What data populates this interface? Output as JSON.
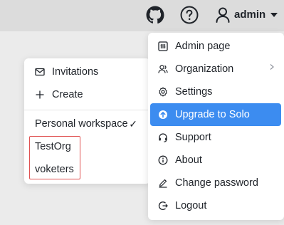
{
  "header": {
    "github_icon": "github-icon",
    "help_icon": "help-icon",
    "user_icon": "user-icon",
    "username": "admin"
  },
  "workspace_menu": {
    "items": [
      {
        "label": "Invitations",
        "icon": "mail-icon"
      },
      {
        "label": "Create",
        "icon": "plus-icon"
      }
    ],
    "workspaces": [
      {
        "label": "Personal workspace",
        "checked": true,
        "check": "✓"
      },
      {
        "label": "TestOrg"
      },
      {
        "label": "voketers"
      }
    ]
  },
  "user_menu": {
    "items": [
      {
        "label": "Admin page",
        "icon": "admin-page-icon"
      },
      {
        "label": "Organization",
        "icon": "organization-icon",
        "has_submenu": true
      },
      {
        "label": "Settings",
        "icon": "gear-icon"
      },
      {
        "label": "Upgrade to Solo",
        "icon": "upgrade-icon",
        "active": true
      },
      {
        "label": "Support",
        "icon": "headset-icon"
      },
      {
        "label": "About",
        "icon": "info-icon"
      },
      {
        "label": "Change password",
        "icon": "pencil-icon"
      },
      {
        "label": "Logout",
        "icon": "logout-icon"
      }
    ]
  },
  "colors": {
    "accent": "#3c8cf0",
    "highlight_border": "#e05252",
    "topbar": "#dcdcdc",
    "background": "#ebebeb"
  }
}
